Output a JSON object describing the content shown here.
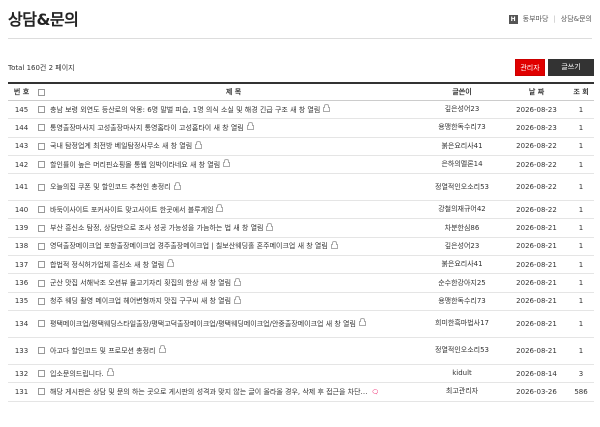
{
  "page": {
    "title": "상담&문의"
  },
  "breadcrumb": {
    "home_icon": "H",
    "first": "동부마당",
    "second": "상담&문의"
  },
  "board": {
    "total_text": "Total 160건 2 페이지",
    "admin_label": "관리자",
    "write_label": "글쓰기",
    "headers": {
      "no": "번 호",
      "subject": "제 목",
      "writer": "글쓴이",
      "date": "날 짜",
      "views": "조 회"
    },
    "rows": [
      {
        "no": "145",
        "subject": "충남 보령 외연도 등산로의 악몽: 6명 말벌 피습, 1명 의식 소실 및 해경 긴급 구조",
        "suffix": "새 창 열림",
        "lock": true,
        "writer": "깊은성어23",
        "date": "2026-08-23",
        "views": "1"
      },
      {
        "no": "144",
        "subject": "통영출장마사지 고성출장마사지 통영홈타이 고성홈타이",
        "suffix": "새 창 열림",
        "lock": true,
        "writer": "용맹한독수리73",
        "date": "2026-08-23",
        "views": "1"
      },
      {
        "no": "143",
        "subject": "국내 탐정업계 최전방 베일탐정사무소",
        "suffix": "새 창 열림",
        "lock": true,
        "writer": "붉은요리사41",
        "date": "2026-08-22",
        "views": "1"
      },
      {
        "no": "142",
        "subject": "할인률이 높은 머리핀쇼핑몰 통웹 임박이라네요",
        "suffix": "새 창 열림",
        "lock": true,
        "writer": "은하의멜론14",
        "date": "2026-08-22",
        "views": "1"
      },
      {
        "no": "141",
        "subject": "오늘의집 쿠폰 및 할인코드 추천인 총정리",
        "suffix": "",
        "lock": true,
        "writer": "정열적인오소리53",
        "date": "2026-08-22",
        "views": "1"
      },
      {
        "no": "140",
        "subject": "바둑이사이트 포커사이트 맞고사이트 한곳에서 블루게임",
        "suffix": "",
        "lock": true,
        "writer": "강철의재규어42",
        "date": "2026-08-22",
        "views": "1"
      },
      {
        "no": "139",
        "subject": "부산 흥신소 탐정, 상담만으로 조사 성공 가능성을 가늠하는 법",
        "suffix": "새 창 열림",
        "lock": true,
        "writer": "차분한심86",
        "date": "2026-08-21",
        "views": "1"
      },
      {
        "no": "138",
        "subject": "영덕출장메이크업 포항출장메이크업 경주출장메이크업 | 칠보산웨딩홀 혼주메이크업",
        "suffix": "새 창 열림",
        "lock": true,
        "writer": "깊은성어23",
        "date": "2026-08-21",
        "views": "1"
      },
      {
        "no": "137",
        "subject": "합법적 정식허가업체 흥신소",
        "suffix": "새 창 열림",
        "lock": true,
        "writer": "붉은요리사41",
        "date": "2026-08-21",
        "views": "1"
      },
      {
        "no": "136",
        "subject": "군산 맛집 서해낙조 오션뷰 물고기자리 횟집의 한상",
        "suffix": "새 창 열림",
        "lock": true,
        "writer": "순수한강아지25",
        "date": "2026-08-21",
        "views": "1"
      },
      {
        "no": "135",
        "subject": "청주 웨딩 촬영 메이크업 헤어변형까지 맛집 구구씨",
        "suffix": "새 창 열림",
        "lock": true,
        "writer": "용맹한독수리73",
        "date": "2026-08-21",
        "views": "1"
      },
      {
        "no": "134",
        "subject": "평택메이크업/평택웨딩스타일출장/평택고덕출장메이크업/평택웨딩메이크업/안중출장메이크업",
        "suffix": "새 창 열림",
        "lock": true,
        "writer": "희미한흑마법사17",
        "date": "2026-08-21",
        "views": "1"
      },
      {
        "no": "133",
        "subject": "아고다 할인코드 및 프로모션 총정리",
        "suffix": "",
        "lock": true,
        "writer": "정열적인오소리53",
        "date": "2026-08-21",
        "views": "1"
      },
      {
        "no": "132",
        "subject": "입소문의드립니다.",
        "suffix": "",
        "lock": true,
        "writer": "kidult",
        "date": "2026-08-14",
        "views": "3"
      },
      {
        "no": "131",
        "subject": "해당 게시판은 상담 및 문의 하는 곳으로 게시판의 성격과 맞지 않는 글이 올라올 경우, 삭제 후 접근을 차단…",
        "suffix": "",
        "lock": false,
        "notice": "🗨",
        "writer": "최고관리자",
        "date": "2026-03-26",
        "views": "586"
      }
    ]
  }
}
